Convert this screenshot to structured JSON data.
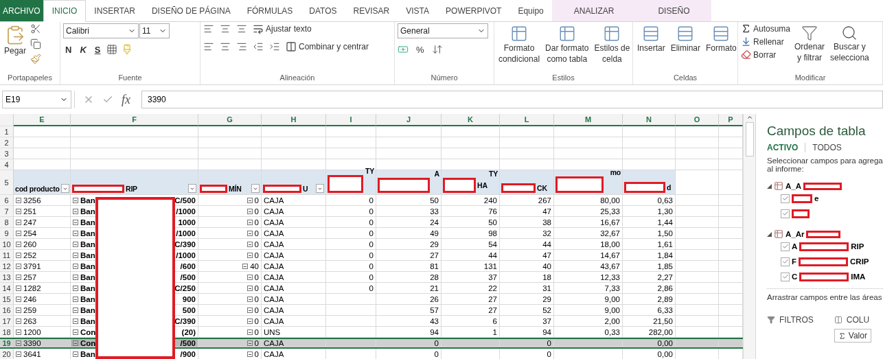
{
  "tabs": [
    {
      "label": "ARCHIVO",
      "kind": "file",
      "selected": false
    },
    {
      "label": "INICIO",
      "kind": "normal",
      "selected": true
    },
    {
      "label": "INSERTAR",
      "kind": "normal",
      "selected": false
    },
    {
      "label": "DISEÑO DE PÁGINA",
      "kind": "normal",
      "selected": false
    },
    {
      "label": "FÓRMULAS",
      "kind": "normal",
      "selected": false
    },
    {
      "label": "DATOS",
      "kind": "normal",
      "selected": false
    },
    {
      "label": "REVISAR",
      "kind": "normal",
      "selected": false
    },
    {
      "label": "VISTA",
      "kind": "normal",
      "selected": false
    },
    {
      "label": "POWERPIVOT",
      "kind": "normal",
      "selected": false
    },
    {
      "label": "Equipo",
      "kind": "normal",
      "selected": false
    },
    {
      "label": "ANALIZAR",
      "kind": "contextual",
      "selected": false
    },
    {
      "label": "DISEÑO",
      "kind": "contextual",
      "selected": false
    }
  ],
  "ribbon": {
    "clipboard": {
      "paste": "Pegar",
      "label": "Portapapeles"
    },
    "font": {
      "name": "Calibri",
      "size": "11",
      "bold": "N",
      "italic": "K",
      "underline": "S",
      "label": "Fuente"
    },
    "alignment": {
      "wrap": "Ajustar texto",
      "merge": "Combinar y centrar",
      "label": "Alineación"
    },
    "number": {
      "format": "General",
      "percent": "%",
      "label": "Número"
    },
    "styles": {
      "label": "Estilos",
      "buttons": [
        {
          "lines": [
            "Formato",
            "condicional"
          ]
        },
        {
          "lines": [
            "Dar formato",
            "como tabla"
          ]
        },
        {
          "lines": [
            "Estilos de",
            "celda"
          ]
        }
      ]
    },
    "cells": {
      "label": "Celdas",
      "buttons": [
        {
          "lines": [
            "Insertar"
          ]
        },
        {
          "lines": [
            "Eliminar"
          ]
        },
        {
          "lines": [
            "Formato"
          ]
        }
      ]
    },
    "editing": {
      "label": "Modificar",
      "autosum": "Autosuma",
      "fill": "Rellenar",
      "clear": "Borrar",
      "buttons": [
        {
          "lines": [
            "Ordenar",
            "y filtrar"
          ]
        },
        {
          "lines": [
            "Buscar y",
            "selecciona"
          ]
        }
      ]
    }
  },
  "formula_bar": {
    "name_box": "E19",
    "function_label": "fx",
    "value": "3390"
  },
  "grid": {
    "columns": [
      "E",
      "F",
      "G",
      "H",
      "I",
      "J",
      "K",
      "L",
      "M",
      "N",
      "O",
      "P"
    ],
    "column_redaction": true,
    "empty_rows": [
      "1",
      "2",
      "3",
      "4"
    ],
    "header_row": {
      "number": "5",
      "cells": [
        {
          "bottom": "cod producto",
          "filter": true,
          "redacted": false
        },
        {
          "bottom": "RIP",
          "filter": true,
          "redacted": true
        },
        {
          "bottom": "MÍN",
          "filter": true,
          "redacted": true
        },
        {
          "bottom": "U",
          "filter": true,
          "redacted": true
        },
        {
          "top": "TY",
          "filter": false,
          "redacted": true
        },
        {
          "top": "A",
          "filter": false,
          "redacted": true
        },
        {
          "top": "TY",
          "bottom": "HA",
          "filter": false,
          "redacted": true
        },
        {
          "bottom": "CK",
          "filter": false,
          "redacted": true
        },
        {
          "top": "mo",
          "filter": false,
          "redacted": true
        },
        {
          "bottom": "d",
          "filter": false,
          "redacted": true
        }
      ]
    },
    "rows": [
      {
        "number": "6",
        "selected": false,
        "cells": {
          "code": "3256",
          "desc_start": "Ban",
          "desc_end": "C/500",
          "min": "0",
          "unit": "CAJA",
          "i": "0",
          "j": "50",
          "k": "240",
          "l": "267",
          "m": "80,00",
          "n": "0,63"
        }
      },
      {
        "number": "7",
        "selected": false,
        "cells": {
          "code": "251",
          "desc_start": "Ban",
          "desc_end": "/1000",
          "min": "0",
          "unit": "CAJA",
          "i": "0",
          "j": "33",
          "k": "76",
          "l": "47",
          "m": "25,33",
          "n": "1,30"
        }
      },
      {
        "number": "8",
        "selected": false,
        "cells": {
          "code": "247",
          "desc_start": "Ban",
          "desc_end": "1000",
          "min": "0",
          "unit": "CAJA",
          "i": "0",
          "j": "24",
          "k": "50",
          "l": "38",
          "m": "16,67",
          "n": "1,44"
        }
      },
      {
        "number": "9",
        "selected": false,
        "cells": {
          "code": "254",
          "desc_start": "Ban",
          "desc_end": "/1000",
          "min": "0",
          "unit": "CAJA",
          "i": "0",
          "j": "49",
          "k": "98",
          "l": "32",
          "m": "32,67",
          "n": "1,50"
        }
      },
      {
        "number": "10",
        "selected": false,
        "cells": {
          "code": "260",
          "desc_start": "Ban",
          "desc_end": "C/390",
          "min": "0",
          "unit": "CAJA",
          "i": "0",
          "j": "29",
          "k": "54",
          "l": "44",
          "m": "18,00",
          "n": "1,61"
        }
      },
      {
        "number": "11",
        "selected": false,
        "cells": {
          "code": "252",
          "desc_start": "Ban",
          "desc_end": "/1000",
          "min": "0",
          "unit": "CAJA",
          "i": "0",
          "j": "27",
          "k": "44",
          "l": "47",
          "m": "14,67",
          "n": "1,84"
        }
      },
      {
        "number": "12",
        "selected": false,
        "cells": {
          "code": "3791",
          "desc_start": "Ban",
          "desc_end": "/600",
          "min": "40",
          "unit": "CAJA",
          "i": "0",
          "j": "81",
          "k": "131",
          "l": "40",
          "m": "43,67",
          "n": "1,85"
        }
      },
      {
        "number": "13",
        "selected": false,
        "cells": {
          "code": "257",
          "desc_start": "Ban",
          "desc_end": "/500",
          "min": "0",
          "unit": "CAJA",
          "i": "0",
          "j": "28",
          "k": "37",
          "l": "18",
          "m": "12,33",
          "n": "2,27"
        }
      },
      {
        "number": "14",
        "selected": false,
        "cells": {
          "code": "1282",
          "desc_start": "Ban",
          "desc_end": "C/250",
          "min": "0",
          "unit": "CAJA",
          "i": "0",
          "j": "21",
          "k": "22",
          "l": "31",
          "m": "7,33",
          "n": "2,86"
        }
      },
      {
        "number": "15",
        "selected": false,
        "cells": {
          "code": "246",
          "desc_start": "Ban",
          "desc_end": "900",
          "min": "0",
          "unit": "CAJA",
          "j": "26",
          "k": "27",
          "l": "29",
          "m": "9,00",
          "n": "2,89"
        }
      },
      {
        "number": "16",
        "selected": false,
        "cells": {
          "code": "259",
          "desc_start": "Ban",
          "desc_end": "500",
          "min": "0",
          "unit": "CAJA",
          "j": "57",
          "k": "27",
          "l": "52",
          "m": "9,00",
          "n": "6,33"
        }
      },
      {
        "number": "17",
        "selected": false,
        "cells": {
          "code": "263",
          "desc_start": "Ban",
          "desc_end": "C/390",
          "min": "0",
          "unit": "CAJA",
          "j": "43",
          "k": "6",
          "l": "37",
          "m": "2,00",
          "n": "21,50"
        }
      },
      {
        "number": "18",
        "selected": false,
        "cells": {
          "code": "1200",
          "desc_start": "Con",
          "desc_end": "(20)",
          "min": "0",
          "unit": "UNS",
          "j": "94",
          "k": "1",
          "l": "94",
          "m": "0,33",
          "n": "282,00"
        }
      },
      {
        "number": "19",
        "selected": true,
        "cells": {
          "code": "3390",
          "desc_start": "Con",
          "desc_end": "/500",
          "min": "0",
          "unit": "CAJA",
          "j": "0",
          "l": "0",
          "n": "0,00"
        }
      },
      {
        "number": "20",
        "selected": false,
        "cells": {
          "code": "3641",
          "desc_start": "Ban",
          "desc_end": "/900",
          "min": "0",
          "unit": "CAJA",
          "j": "0",
          "l": "0",
          "n": "0,00"
        }
      }
    ]
  },
  "field_pane": {
    "title": "Campos de tabla",
    "tabs": [
      {
        "label": "ACTIVO",
        "selected": true
      },
      {
        "label": "TODOS",
        "selected": false
      }
    ],
    "instruction": [
      "Seleccionar campos para agrega",
      "al informe:"
    ],
    "tables": [
      {
        "name": "A_A",
        "expanded": true,
        "fields": [
          {
            "suffix": "e",
            "checked": true
          },
          {
            "checked": true
          }
        ]
      },
      {
        "name": "A_Ar",
        "expanded": true,
        "fields": [
          {
            "prefix": "A",
            "suffix": "RIP",
            "checked": true
          },
          {
            "prefix": "F",
            "suffix": "CRIP",
            "checked": true
          },
          {
            "prefix": "C",
            "suffix": "IMA",
            "checked": true
          }
        ]
      }
    ],
    "drag_hint": "Arrastrar campos entre las áreas",
    "areas": [
      {
        "kind": "filters",
        "label": "FILTROS"
      },
      {
        "kind": "columns",
        "label": "COLU",
        "items": [
          "Valor"
        ]
      }
    ]
  }
}
